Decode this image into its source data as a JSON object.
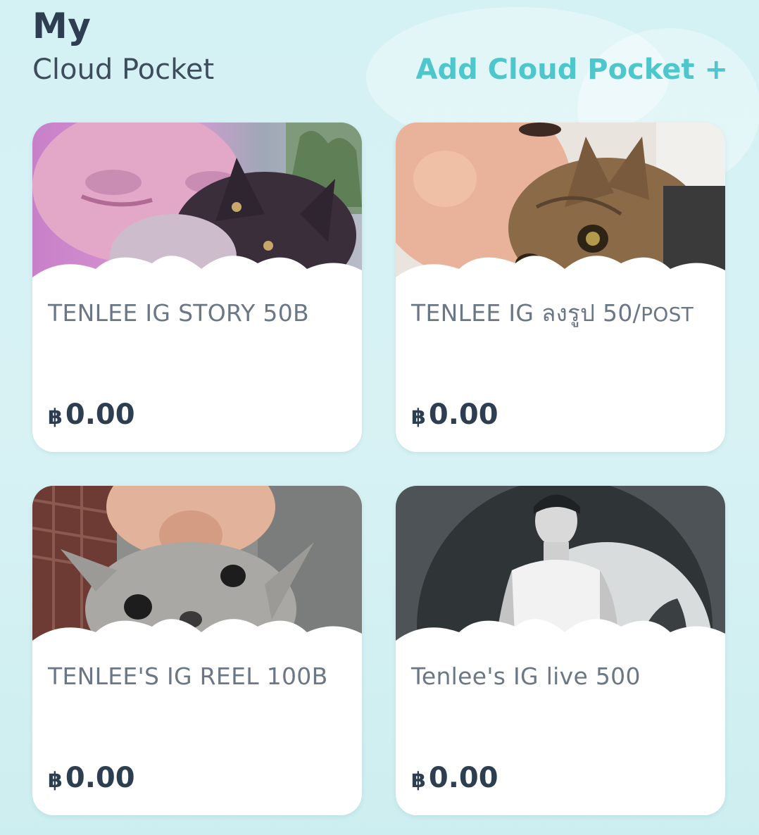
{
  "header": {
    "title": "My",
    "subtitle": "Cloud Pocket",
    "add_label": "Add Cloud Pocket +"
  },
  "pockets": [
    {
      "name": "TENLEE IG STORY 50B",
      "currency": "฿",
      "amount": "0.00",
      "photo": "selfie-with-siamese-cat"
    },
    {
      "name_main": "TENLEE IG ลงรูป 50/",
      "name_suffix": "POST",
      "currency": "฿",
      "amount": "0.00",
      "photo": "selfie-with-tabby-cat"
    },
    {
      "name": "TENLEE'S IG REEL 100B",
      "currency": "฿",
      "amount": "0.00",
      "photo": "kissing-grey-cat"
    },
    {
      "name": "Tenlee's IG live 500",
      "currency": "฿",
      "amount": "0.00",
      "photo": "black-and-white-portrait"
    }
  ],
  "colors": {
    "accent": "#4ec7cc",
    "text_dark": "#2c3e50",
    "text_muted": "#6b7785",
    "background": "#d4f1f3",
    "card": "#ffffff"
  }
}
